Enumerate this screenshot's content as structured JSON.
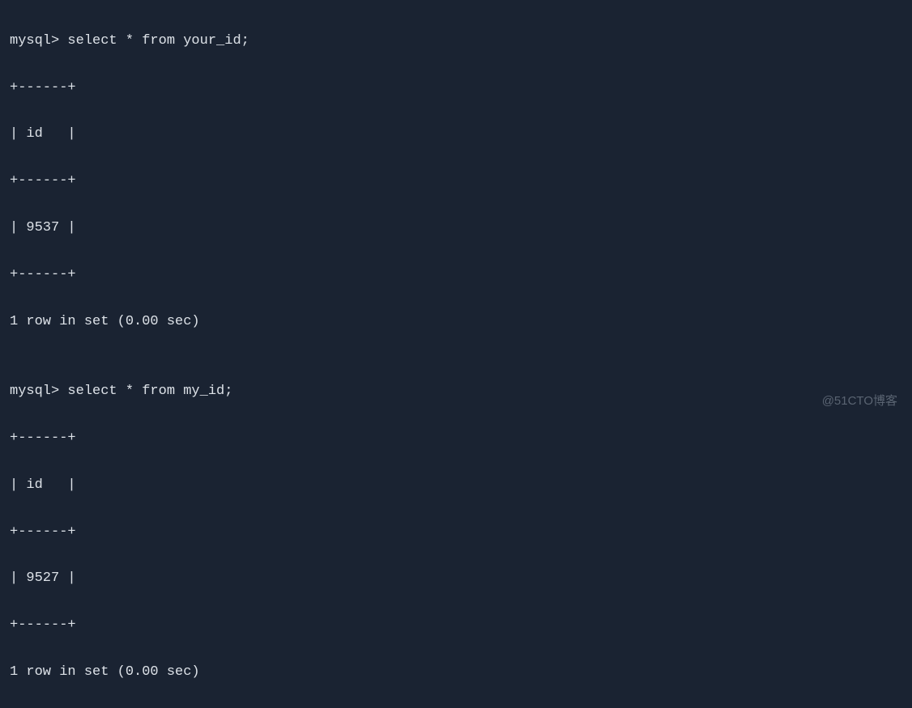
{
  "terminal": {
    "lines": [
      "mysql> select * from your_id;",
      "+------+",
      "| id   |",
      "+------+",
      "| 9537 |",
      "+------+",
      "1 row in set (0.00 sec)",
      "",
      "mysql> select * from my_id;",
      "+------+",
      "| id   |",
      "+------+",
      "| 9527 |",
      "+------+",
      "1 row in set (0.00 sec)"
    ]
  },
  "watermark": "@51CTO博客"
}
